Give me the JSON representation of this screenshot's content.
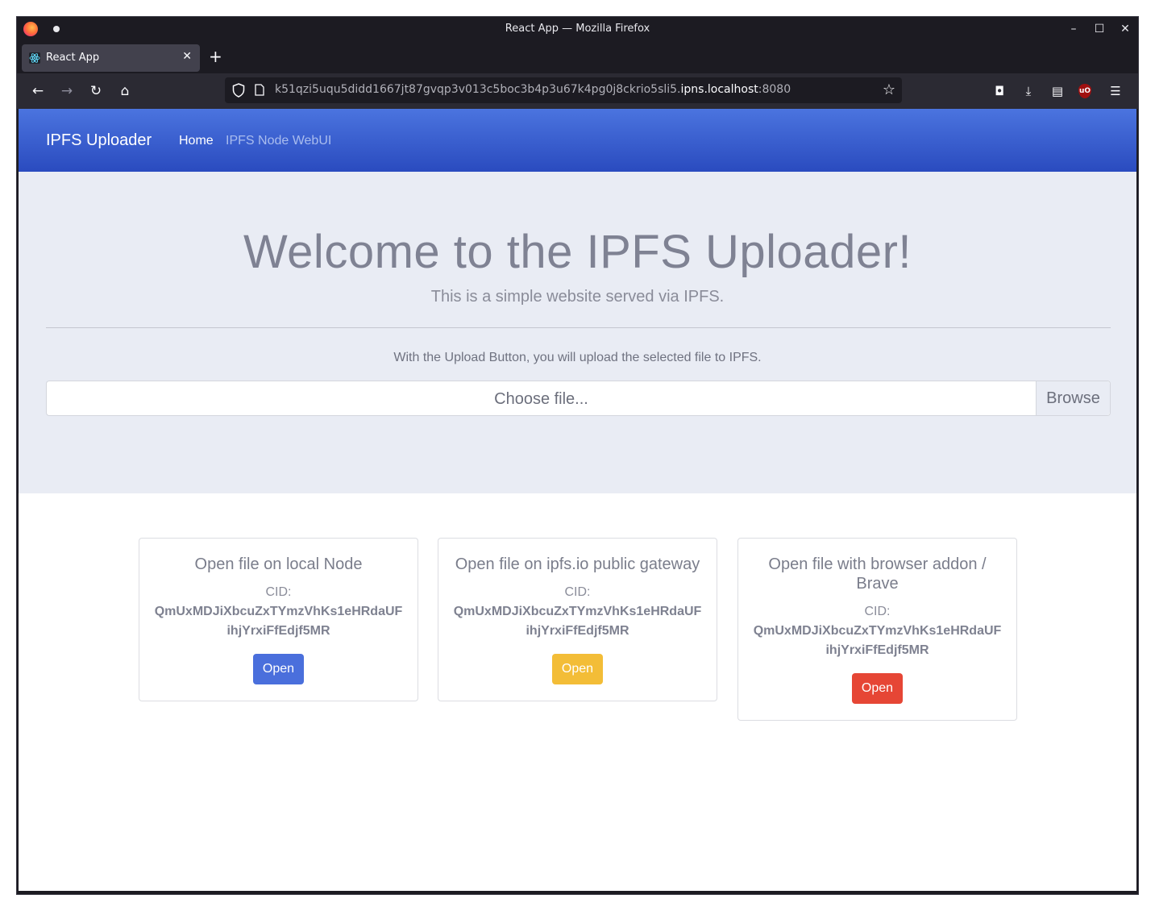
{
  "window": {
    "title": "React App — Mozilla Firefox",
    "controls": {
      "minimize": "–",
      "maximize": "☐",
      "close": "✕"
    }
  },
  "tabs": [
    {
      "title": "React App",
      "close": "✕"
    }
  ],
  "newtab_label": "+",
  "nav": {
    "back": "←",
    "forward": "→",
    "reload": "↻",
    "home": "⌂",
    "url_prefix": "k51qzi5uqu5didd1667jt87gvqp3v013c5boc3b4p3u67k4pg0j8ckrio5sli5.",
    "url_host": "ipns.localhost",
    "url_port": ":8080",
    "bookmark_star": "☆",
    "tools": {
      "pocket": "◘",
      "downloads": "⤓",
      "reader": "▤",
      "ublock": "uO",
      "menu": "☰"
    }
  },
  "site": {
    "brand": "IPFS Uploader",
    "nav_links": [
      "Home",
      "IPFS Node WebUI"
    ],
    "heading": "Welcome to the IPFS Uploader!",
    "lead": "This is a simple website served via IPFS.",
    "upload_hint": "With the Upload Button, you will upload the selected file to IPFS.",
    "file_placeholder": "Choose file...",
    "browse_label": "Browse"
  },
  "cards": [
    {
      "title": "Open file on local Node",
      "cid_label": "CID:",
      "cid": "QmUxMDJiXbcuZxTYmzVhKs1eHRdaUFihjYrxiFfEdjf5MR",
      "button": "Open"
    },
    {
      "title": "Open file on ipfs.io public gateway",
      "cid_label": "CID:",
      "cid": "QmUxMDJiXbcuZxTYmzVhKs1eHRdaUFihjYrxiFfEdjf5MR",
      "button": "Open"
    },
    {
      "title": "Open file with browser addon / Brave",
      "cid_label": "CID:",
      "cid": "QmUxMDJiXbcuZxTYmzVhKs1eHRdaUFihjYrxiFfEdjf5MR",
      "button": "Open"
    }
  ],
  "colors": {
    "navbar_gradient_top": "#4b74df",
    "navbar_gradient_bottom": "#2a4bbf",
    "button_primary": "#4a6fdc",
    "button_warning": "#f3bd37",
    "button_danger": "#e64635"
  }
}
